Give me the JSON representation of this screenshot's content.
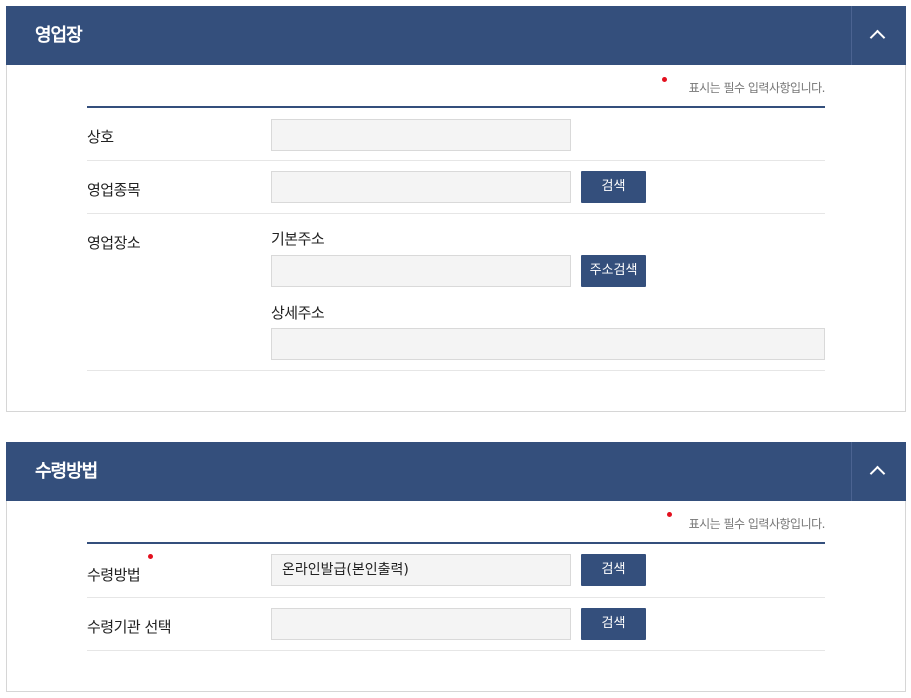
{
  "sections": [
    {
      "title": "영업장",
      "required_note": "표시는 필수 입력사항입니다.",
      "fields": {
        "trade_name": {
          "label": "상호",
          "value": ""
        },
        "business_type": {
          "label": "영업종목",
          "value": "",
          "button": "검색"
        },
        "business_place": {
          "label": "영업장소",
          "basic_address_label": "기본주소",
          "basic_address_value": "",
          "address_button": "주소검색",
          "detail_address_label": "상세주소",
          "detail_address_value": ""
        }
      }
    },
    {
      "title": "수령방법",
      "required_note": "표시는 필수 입력사항입니다.",
      "fields": {
        "receive_method": {
          "label": "수령방법",
          "value": "온라인발급(본인출력)",
          "button": "검색",
          "required": true
        },
        "receive_agency": {
          "label": "수령기관 선택",
          "value": "",
          "button": "검색"
        }
      }
    }
  ],
  "colors": {
    "header": "#344f7c",
    "required": "#e3101e"
  },
  "icons": {
    "toggle": "chevron-up-icon"
  }
}
